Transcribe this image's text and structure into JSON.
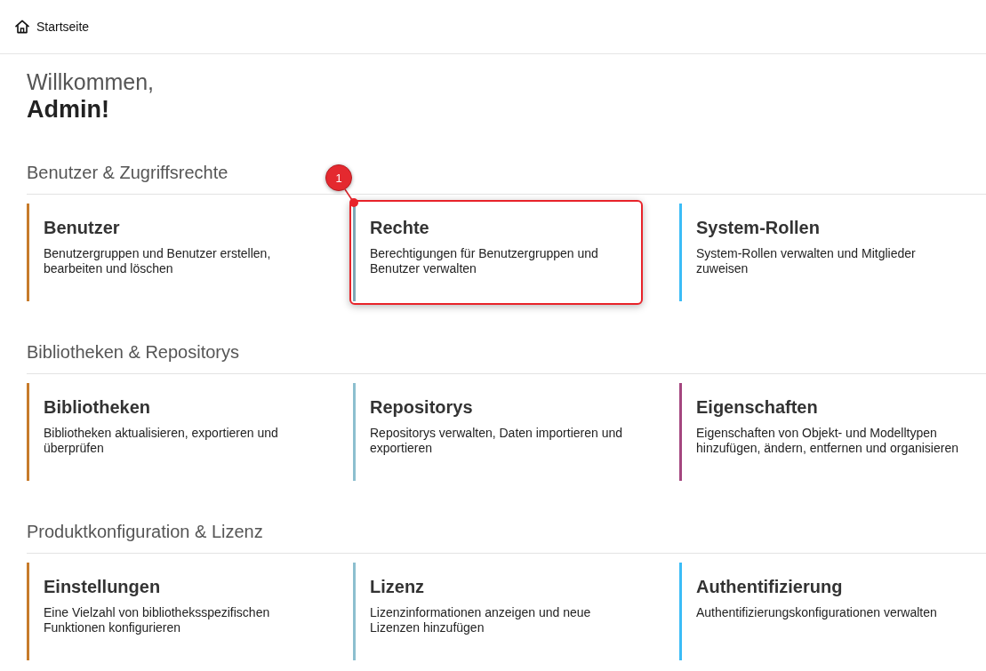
{
  "header": {
    "breadcrumb": "Startseite"
  },
  "welcome": {
    "greeting": "Willkommen,",
    "name": "Admin!"
  },
  "sections": [
    {
      "title": "Benutzer & Zugriffsrechte",
      "cards": [
        {
          "title": "Benutzer",
          "description": "Benutzergruppen und Benutzer erstellen, bearbeiten und löschen",
          "color": "#c77b2b",
          "highlighted": false
        },
        {
          "title": "Rechte",
          "description": "Berechtigungen für Benutzergruppen und Benutzer verwalten",
          "color": "#7fa8b6",
          "highlighted": true,
          "callout": "1"
        },
        {
          "title": "System-Rollen",
          "description": "System-Rollen verwalten und Mitglieder zuweisen",
          "color": "#3bbcf7",
          "highlighted": false
        }
      ]
    },
    {
      "title": "Bibliotheken & Repositorys",
      "cards": [
        {
          "title": "Bibliotheken",
          "description": "Bibliotheken aktualisieren, exportieren und überprüfen",
          "color": "#c77b2b",
          "highlighted": false
        },
        {
          "title": "Repositorys",
          "description": "Repositorys verwalten, Daten importieren und exportieren",
          "color": "#8cbfcf",
          "highlighted": false
        },
        {
          "title": "Eigenschaften",
          "description": "Eigenschaften von Objekt- und Modelltypen hinzufügen, ändern, entfernen und organisieren",
          "color": "#a4467f",
          "highlighted": false
        }
      ]
    },
    {
      "title": "Produktkonfiguration & Lizenz",
      "cards": [
        {
          "title": "Einstellungen",
          "description": "Eine Vielzahl von bibliotheksspezifischen Funktionen konfigurieren",
          "color": "#c77b2b",
          "highlighted": false
        },
        {
          "title": "Lizenz",
          "description": "Lizenzinformationen anzeigen und neue Lizenzen hinzufügen",
          "color": "#8cbfcf",
          "highlighted": false
        },
        {
          "title": "Authentifizierung",
          "description": "Authentifizierungskonfigurationen verwalten",
          "color": "#3bbcf7",
          "highlighted": false
        }
      ]
    }
  ]
}
